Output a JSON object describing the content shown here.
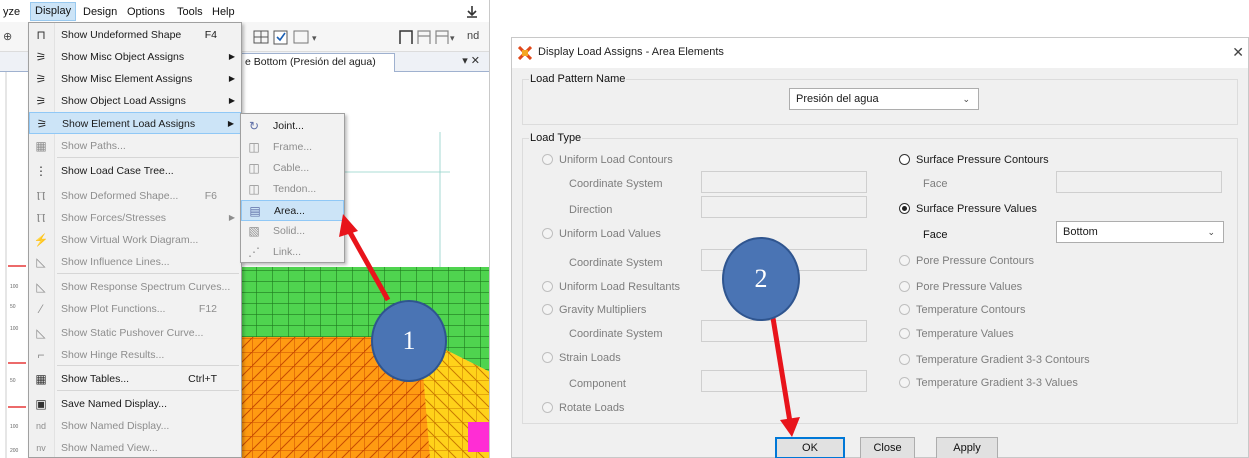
{
  "menubar": {
    "items": [
      "yze",
      "Display",
      "Design",
      "Options",
      "Tools",
      "Help"
    ],
    "active_index": 1
  },
  "toolbar": {
    "trailing_text": "nd"
  },
  "tab": {
    "title": "e Bottom (Presión del agua)",
    "controls": "▾ ✕"
  },
  "display_menu": {
    "items": [
      {
        "icon": "undeformed-shape-icon",
        "label": "Show Undeformed Shape",
        "shortcut": "F4",
        "submenu": false,
        "disabled": false
      },
      {
        "icon": "misc-object-assigns-icon",
        "label": "Show Misc Object Assigns",
        "shortcut": "",
        "submenu": true,
        "disabled": false
      },
      {
        "icon": "misc-element-assigns-icon",
        "label": "Show Misc Element Assigns",
        "shortcut": "",
        "submenu": true,
        "disabled": false
      },
      {
        "icon": "object-load-assigns-icon",
        "label": "Show Object Load Assigns",
        "shortcut": "",
        "submenu": true,
        "disabled": false
      },
      {
        "icon": "element-load-assigns-icon",
        "label": "Show Element Load Assigns",
        "shortcut": "",
        "submenu": true,
        "disabled": false,
        "highlighted": true
      },
      {
        "icon": "paths-icon",
        "label": "Show Paths...",
        "shortcut": "",
        "submenu": false,
        "disabled": true
      },
      {
        "icon": "load-case-tree-icon",
        "label": "Show Load Case Tree...",
        "shortcut": "",
        "submenu": false,
        "disabled": false
      },
      {
        "icon": "deformed-shape-icon",
        "label": "Show Deformed Shape...",
        "shortcut": "F6",
        "submenu": false,
        "disabled": true
      },
      {
        "icon": "forces-stresses-icon",
        "label": "Show Forces/Stresses",
        "shortcut": "",
        "submenu": true,
        "disabled": true
      },
      {
        "icon": "virtual-work-icon",
        "label": "Show Virtual Work Diagram...",
        "shortcut": "",
        "submenu": false,
        "disabled": true
      },
      {
        "icon": "influence-lines-icon",
        "label": "Show Influence Lines...",
        "shortcut": "",
        "submenu": false,
        "disabled": true
      },
      {
        "icon": "response-spectrum-icon",
        "label": "Show Response Spectrum Curves...",
        "shortcut": "",
        "submenu": false,
        "disabled": true
      },
      {
        "icon": "plot-functions-icon",
        "label": "Show Plot Functions...",
        "shortcut": "F12",
        "submenu": false,
        "disabled": true
      },
      {
        "icon": "pushover-curve-icon",
        "label": "Show Static Pushover Curve...",
        "shortcut": "",
        "submenu": false,
        "disabled": true
      },
      {
        "icon": "hinge-results-icon",
        "label": "Show Hinge Results...",
        "shortcut": "",
        "submenu": false,
        "disabled": true
      },
      {
        "icon": "tables-icon",
        "label": "Show Tables...",
        "shortcut": "Ctrl+T",
        "submenu": false,
        "disabled": false
      },
      {
        "icon": "save-named-display-icon",
        "label": "Save Named Display...",
        "shortcut": "",
        "submenu": false,
        "disabled": false
      },
      {
        "icon": "named-display-icon",
        "label": "Show Named Display...",
        "shortcut": "",
        "submenu": false,
        "disabled": true
      },
      {
        "icon": "named-view-icon",
        "label": "Show Named View...",
        "shortcut": "",
        "submenu": false,
        "disabled": true
      }
    ],
    "icon_glyphs": [
      "⊓",
      "⚞",
      "⚞",
      "⚞",
      "⚞",
      "▦",
      "⋮",
      "Ⲡ",
      "Ⲡ",
      "⚡",
      "◺",
      "◺",
      "⁄",
      "◺",
      "⌐",
      "▦",
      "▣",
      "nd",
      "nv"
    ]
  },
  "element_load_submenu": {
    "items": [
      {
        "label": "Joint...",
        "disabled": false
      },
      {
        "label": "Frame...",
        "disabled": true
      },
      {
        "label": "Cable...",
        "disabled": true
      },
      {
        "label": "Tendon...",
        "disabled": true
      },
      {
        "label": "Area...",
        "disabled": false,
        "highlighted": true
      },
      {
        "label": "Solid...",
        "disabled": true
      },
      {
        "label": "Link...",
        "disabled": true
      }
    ]
  },
  "annotations": {
    "step1": "1",
    "step2": "2",
    "arrow_color": "#e8141b",
    "badge_color": "#4a74b4"
  },
  "dialog": {
    "title": "Display Load Assigns - Area Elements",
    "load_pattern": {
      "group_title": "Load Pattern Name",
      "selected": "Presión del agua"
    },
    "load_type": {
      "group_title": "Load Type",
      "left": {
        "uniform_load_contours": "Uniform Load Contours",
        "coordinate_system_1": "Coordinate System",
        "direction": "Direction",
        "uniform_load_values": "Uniform Load Values",
        "coordinate_system_2": "Coordinate System",
        "uniform_load_resultants": "Uniform Load Resultants",
        "gravity_multipliers": "Gravity Multipliers",
        "coordinate_system_3": "Coordinate System",
        "strain_loads": "Strain Loads",
        "component": "Component",
        "rotate_loads": "Rotate Loads"
      },
      "right": {
        "surface_pressure_contours": "Surface Pressure Contours",
        "face_1": "Face",
        "surface_pressure_values": "Surface Pressure Values",
        "face_2": "Face",
        "face_value": "Bottom",
        "pore_pressure_contours": "Pore Pressure Contours",
        "pore_pressure_values": "Pore Pressure Values",
        "temperature_contours": "Temperature Contours",
        "temperature_values": "Temperature Values",
        "temp_gradient_contours": "Temperature Gradient 3-3 Contours",
        "temp_gradient_values": "Temperature Gradient 3-3 Values"
      },
      "selected": "surface_pressure_values"
    },
    "buttons": {
      "ok": "OK",
      "close": "Close",
      "apply": "Apply"
    }
  }
}
